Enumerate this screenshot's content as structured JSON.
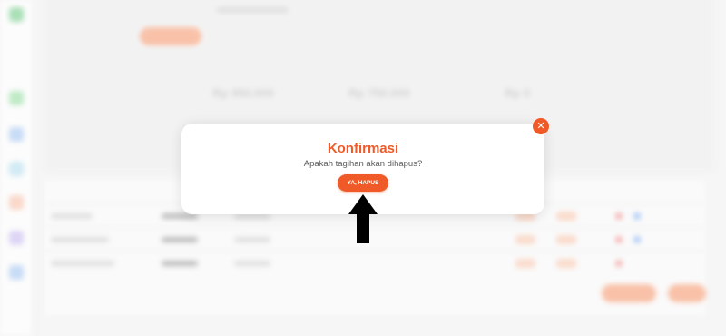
{
  "modal": {
    "title": "Konfirmasi",
    "message": "Apakah tagihan akan dihapus?",
    "confirm_label": "YA, HAPUS",
    "close_icon": "close-icon"
  },
  "background": {
    "summary_values": [
      "Rp 950.000",
      "Rp 750.000",
      "Rp 0"
    ]
  },
  "colors": {
    "accent": "#f05a28",
    "arrow": "#000000"
  }
}
